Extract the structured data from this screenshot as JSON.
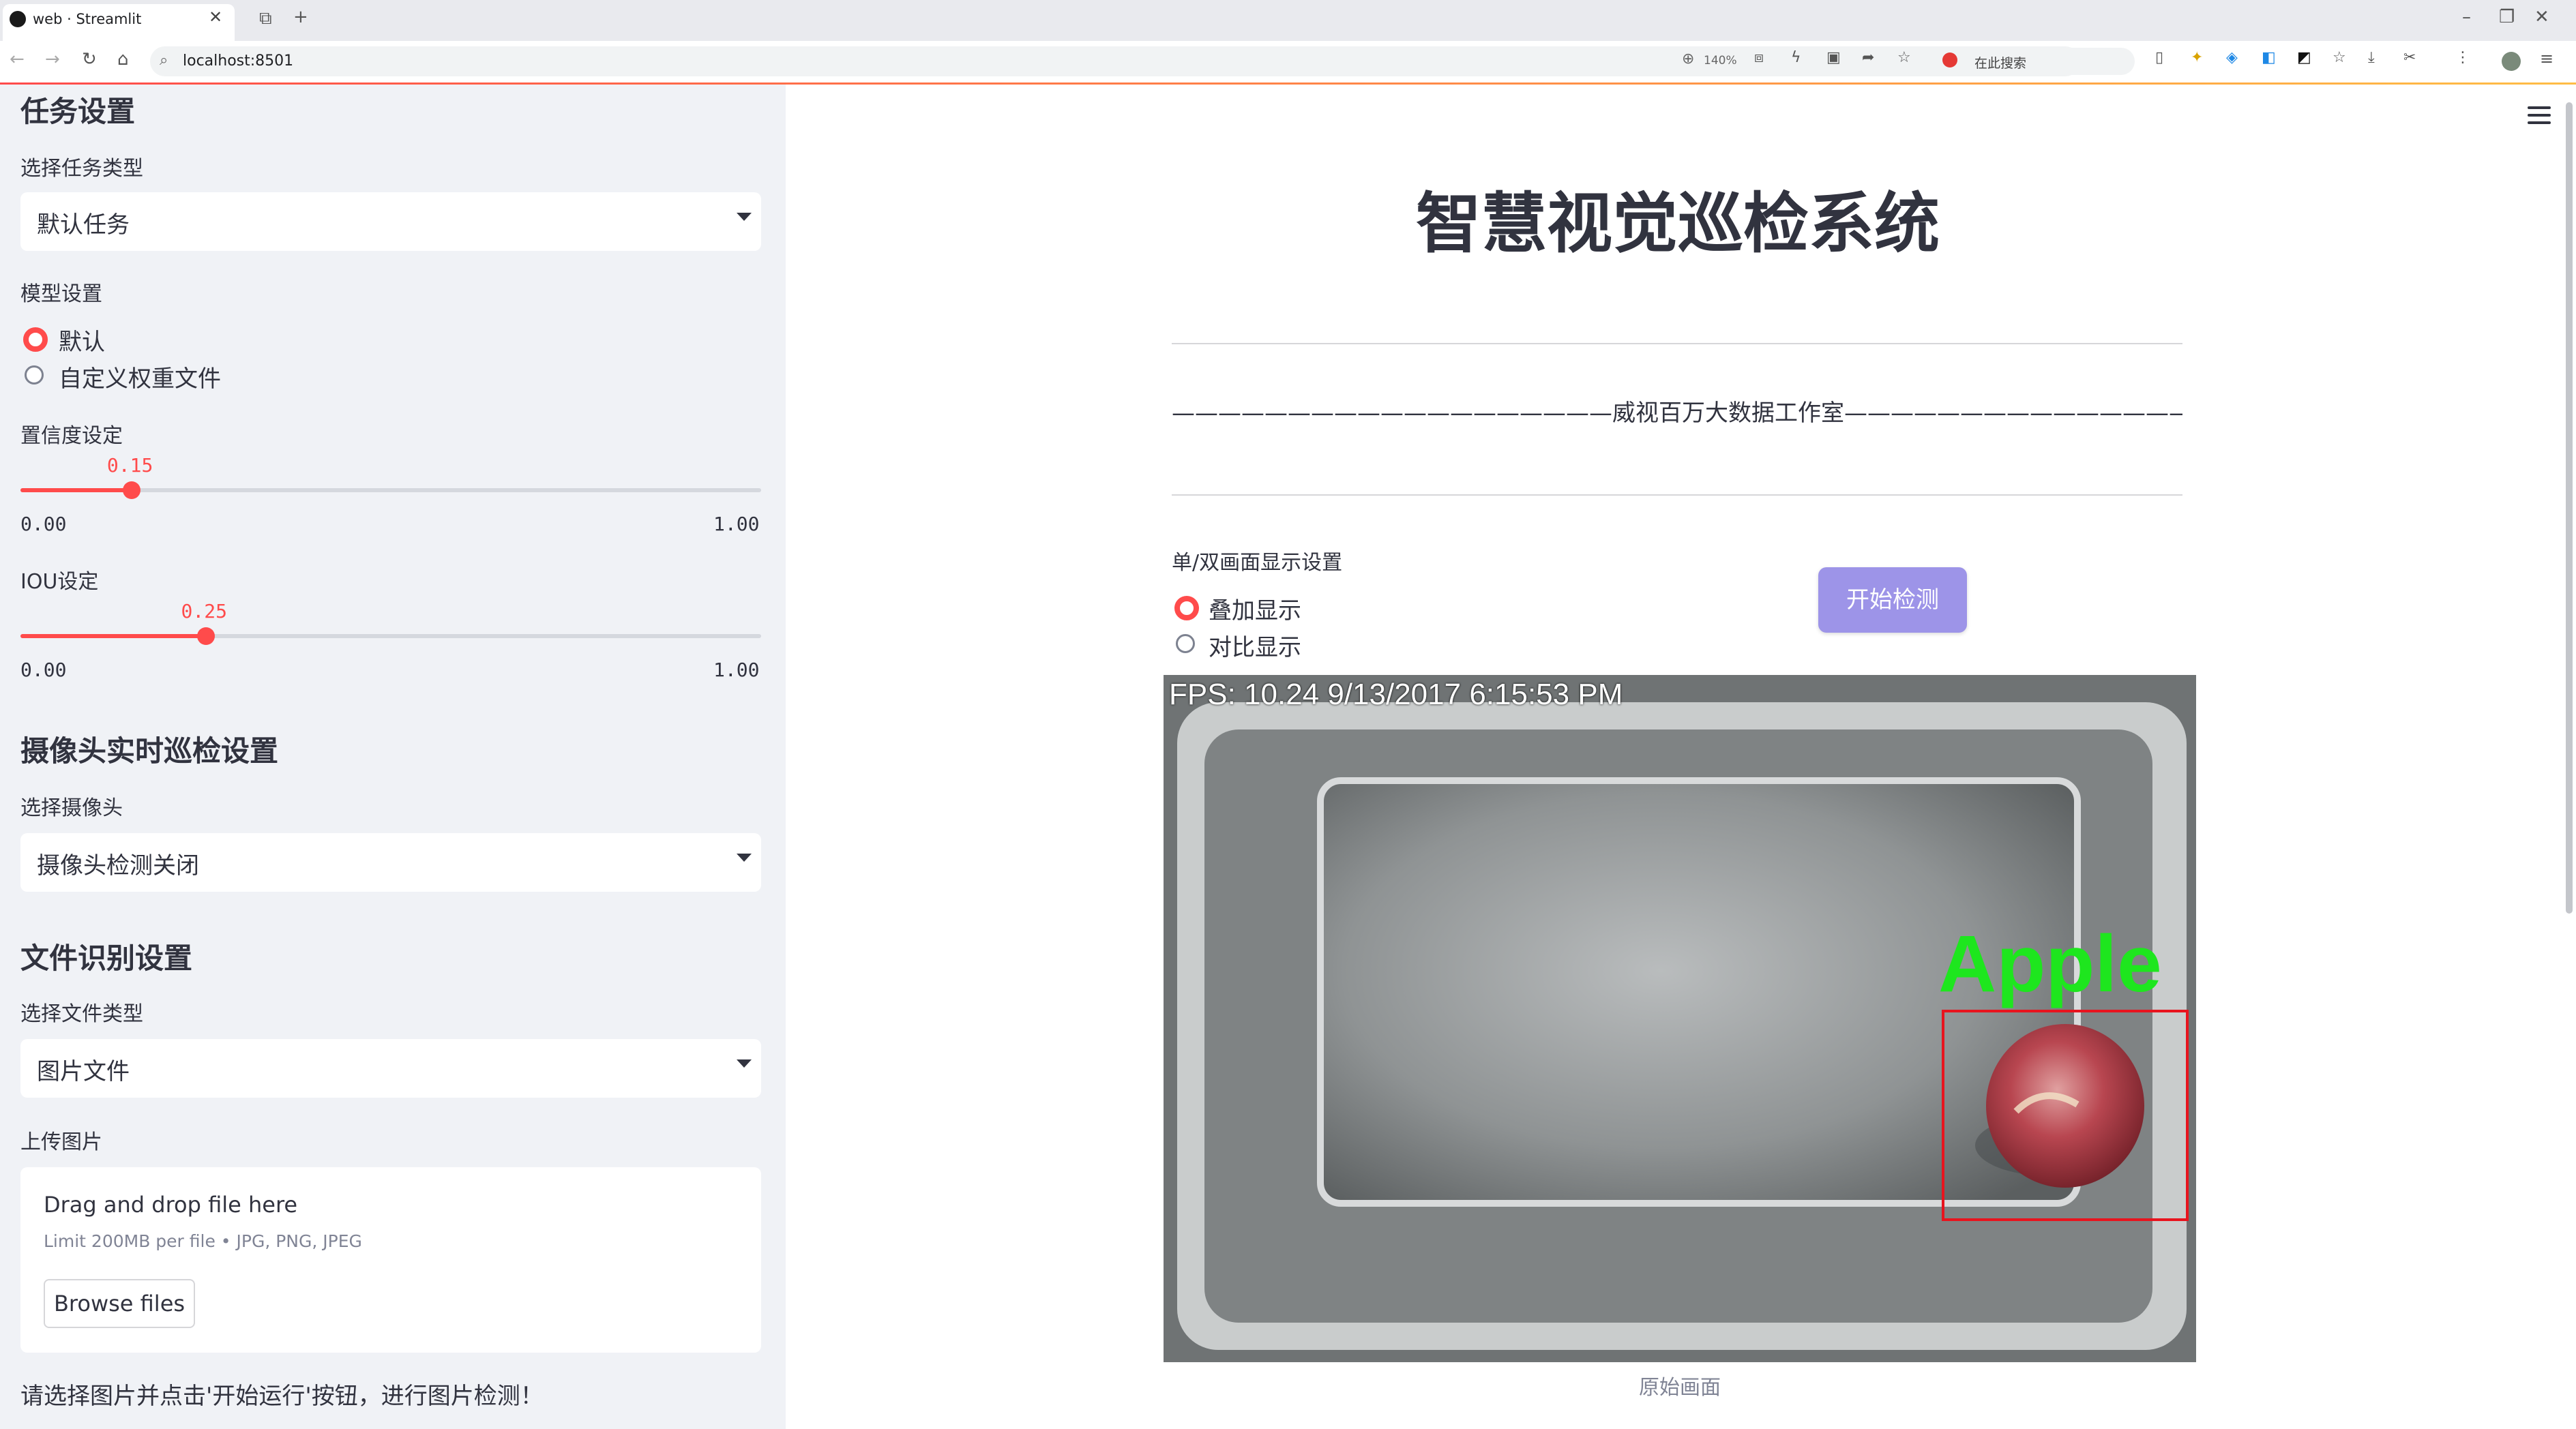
{
  "browser": {
    "tab_title": "web · Streamlit",
    "url": "localhost:8501",
    "zoom": "140%",
    "search_placeholder": "在此搜索"
  },
  "sidebar": {
    "task_header": "任务设置",
    "task_type_label": "选择任务类型",
    "task_type_value": "默认任务",
    "model_label": "模型设置",
    "model_options": [
      "默认",
      "自定义权重文件"
    ],
    "model_selected": "默认",
    "confidence_label": "置信度设定",
    "confidence_value": "0.15",
    "confidence_fraction": 0.15,
    "iou_label": "IOU设定",
    "iou_value": "0.25",
    "iou_fraction": 0.25,
    "slider_min": "0.00",
    "slider_max": "1.00",
    "camera_header": "摄像头实时巡检设置",
    "camera_label": "选择摄像头",
    "camera_value": "摄像头检测关闭",
    "file_header": "文件识别设置",
    "file_type_label": "选择文件类型",
    "file_type_value": "图片文件",
    "upload_label": "上传图片",
    "drop_title": "Drag and drop file here",
    "drop_limit": "Limit 200MB per file • JPG, PNG, JPEG",
    "browse_label": "Browse files",
    "hint": "请选择图片并点击'开始运行'按钮，进行图片检测！"
  },
  "main": {
    "title": "智慧视觉巡检系统",
    "studio": "———————————————————威视百万大数据工作室————————————————————",
    "display_label": "单/双画面显示设置",
    "display_options": [
      "叠加显示",
      "对比显示"
    ],
    "display_selected": "叠加显示",
    "start_button": "开始检测",
    "video_overlay": "FPS: 10.24 9/13/2017 6:15:53 PM",
    "detection_label": "Apple",
    "caption": "原始画面",
    "colors": {
      "accent": "#ff4b4b",
      "button": "#9d94e8",
      "detect_box": "#e8141e",
      "detect_text": "#1ee61e"
    }
  }
}
